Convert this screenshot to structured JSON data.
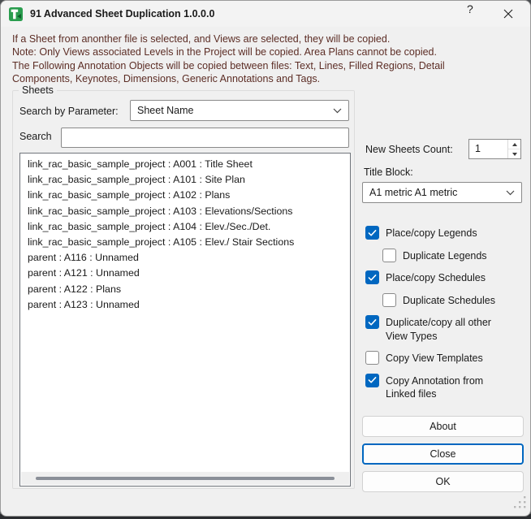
{
  "window": {
    "title": "91 Advanced Sheet Duplication 1.0.0.0",
    "help_glyph": "?",
    "app_icon": "green-t-logo-icon"
  },
  "intro_lines": [
    "If a Sheet from anonther file is selected, and Views are selected, they will be copied.",
    "Note: Only Views associated Levels in the Project will be copied. Area Plans cannot be copied.",
    "The Following Annotation Objects will be copied between files: Text, Lines, Filled Regions, Detail",
    "Components, Keynotes, Dimensions, Generic Annotations and Tags."
  ],
  "sheets_group": {
    "label": "Sheets",
    "search_by_parameter_label": "Search by Parameter:",
    "parameter_value": "Sheet Name",
    "search_label": "Search",
    "search_value": "",
    "items": [
      "link_rac_basic_sample_project : A001 : Title Sheet",
      "link_rac_basic_sample_project : A101 : Site Plan",
      "link_rac_basic_sample_project : A102 : Plans",
      "link_rac_basic_sample_project : A103 : Elevations/Sections",
      "link_rac_basic_sample_project : A104 : Elev./Sec./Det.",
      "link_rac_basic_sample_project : A105 : Elev./ Stair Sections",
      "parent : A116 : Unnamed",
      "parent : A121 : Unnamed",
      "parent : A122 : Plans",
      "parent : A123 : Unnamed"
    ]
  },
  "options": {
    "new_sheets_count_label": "New Sheets Count:",
    "new_sheets_count_value": "1",
    "title_block_label": "Title Block:",
    "title_block_value": "A1 metric A1 metric",
    "checkboxes": [
      {
        "label": "Place/copy Legends",
        "checked": true,
        "indent": false
      },
      {
        "label": "Duplicate Legends",
        "checked": false,
        "indent": true
      },
      {
        "label": "Place/copy Schedules",
        "checked": true,
        "indent": false
      },
      {
        "label": "Duplicate Schedules",
        "checked": false,
        "indent": true
      },
      {
        "label": "Duplicate/copy all other View Types",
        "checked": true,
        "indent": false
      },
      {
        "label": "Copy View Templates",
        "checked": false,
        "indent": false
      },
      {
        "label": "Copy Annotation from Linked files",
        "checked": true,
        "indent": false
      }
    ]
  },
  "buttons": {
    "about": "About",
    "close": "Close",
    "ok": "OK"
  },
  "colors": {
    "accent": "#0067c0",
    "warning_text": "#5c2d25",
    "checkbox_checked": "#0067c0",
    "icon_green": "#2a9d4e",
    "dialog_background": "#f0f0f0"
  }
}
